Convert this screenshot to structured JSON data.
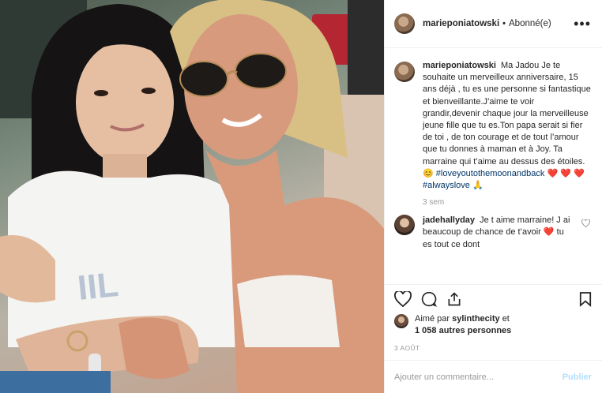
{
  "header": {
    "username": "marieponiatowski",
    "separator": "•",
    "follow_status": "Abonné(e)",
    "more": "•••"
  },
  "caption": {
    "username": "marieponiatowski",
    "text": "Ma Jadou Je te souhaite un merveilleux anniversaire, 15 ans déjà , tu es une personne si fantastique et bienveillante.J’aime te voir grandir,devenir chaque jour la merveilleuse jeune fille que tu es.Ton papa serait si fier de toi , de ton courage et de tout l’amour que tu donnes à maman et à Joy. Ta marraine qui t’aime au dessus des étoiles.",
    "emoji_smile": "😊",
    "hashtag1": "#loveyoutothemoonandback",
    "hearts1": "❤️ ❤️",
    "hearts2": "❤️",
    "hashtag2": "#alwayslove",
    "emoji_pray": "🙏",
    "time": "3 sem"
  },
  "comment": {
    "username": "jadehallyday",
    "text": "Je t aime marraine! J ai beaucoup de chance de t’avoir ❤️ tu es tout ce dont"
  },
  "actions": {
    "liked_by_prefix": "Aimé par",
    "liked_by_user": "sylinthecity",
    "liked_by_conj": "et",
    "others": "1 058 autres personnes",
    "date": "3 août"
  },
  "add_comment": {
    "placeholder": "Ajouter un commentaire...",
    "publish": "Publier"
  }
}
